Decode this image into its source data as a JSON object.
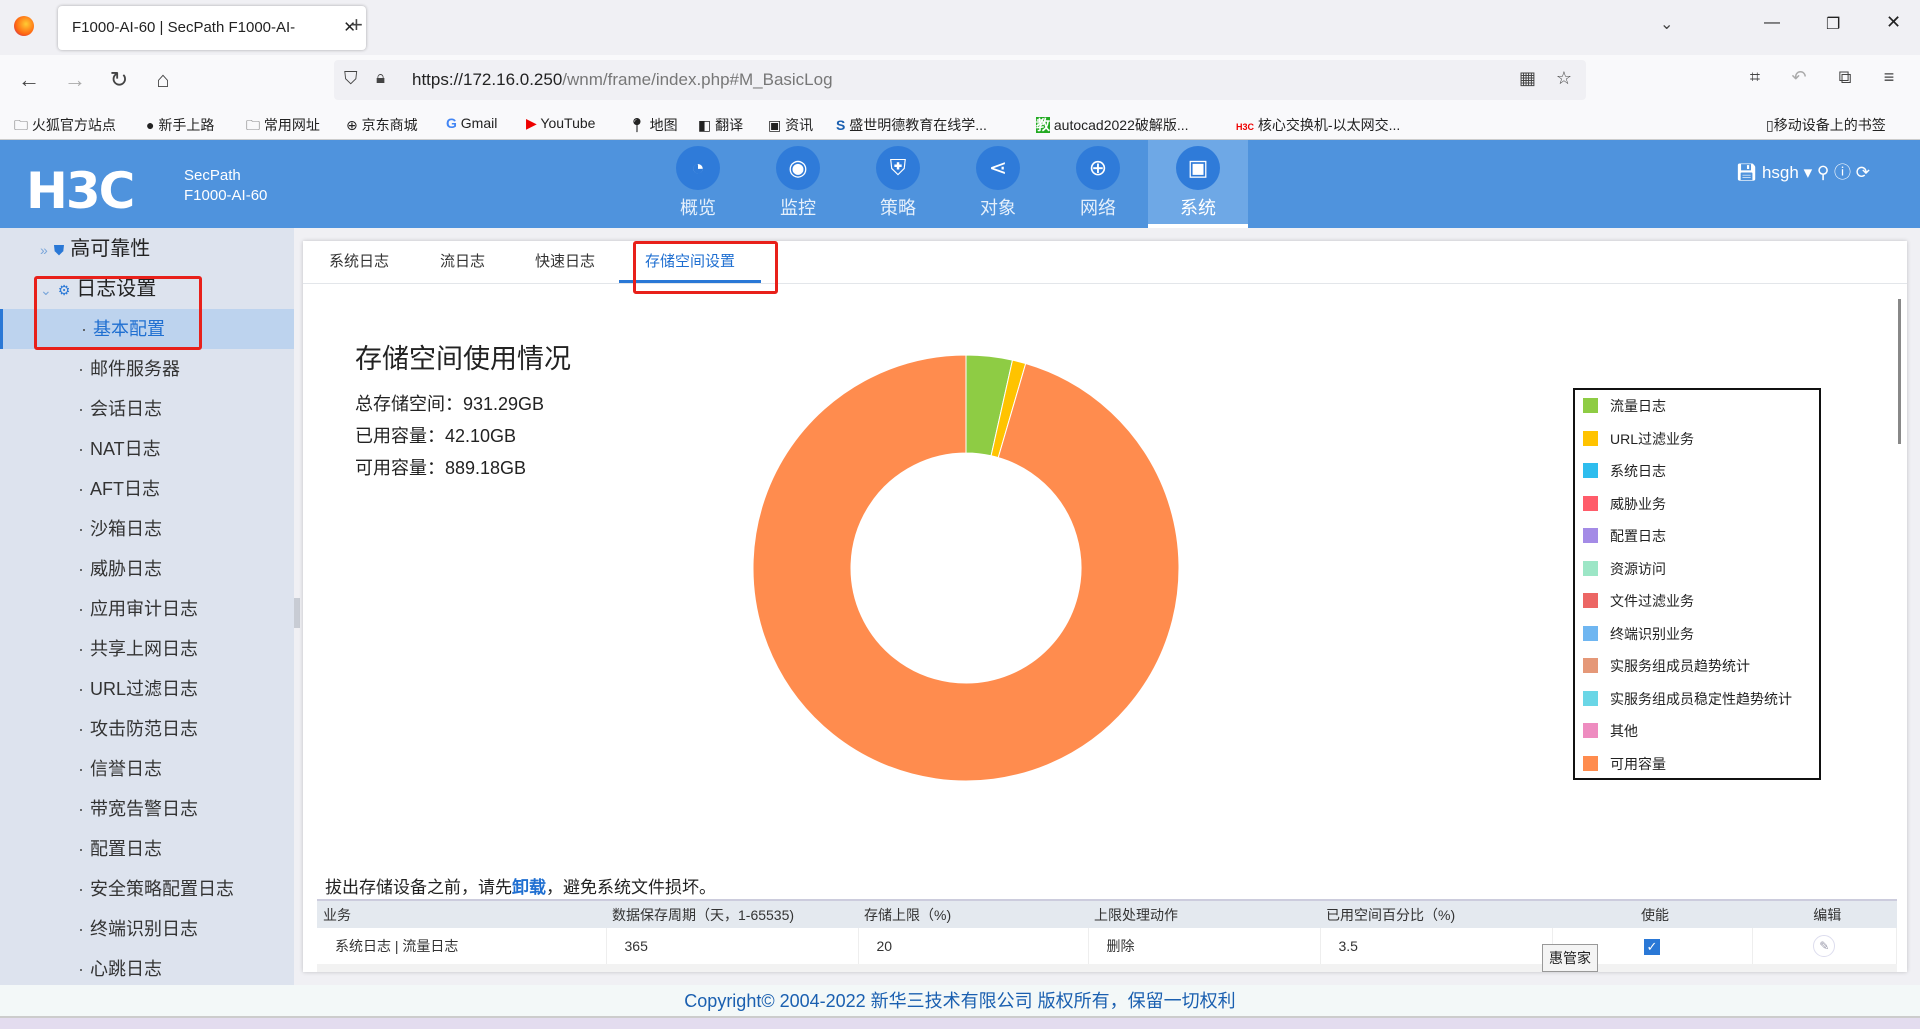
{
  "browser": {
    "tab_title": "F1000-AI-60 | SecPath F1000-AI-",
    "url_host": "https://172.16.0.250",
    "url_path": "/wnm/frame/index.php#M_BasicLog",
    "bookmarks": [
      "火狐官方站点",
      "新手上路",
      "常用网址",
      "京东商城",
      "Gmail",
      "YouTube",
      "地图",
      "翻译",
      "资讯",
      "盛世明德教育在线学...",
      "autocad2022破解版...",
      "核心交换机-以太网交..."
    ],
    "mobile_bookmarks": "移动设备上的书签"
  },
  "header": {
    "logo": "H3C",
    "product": "SecPath",
    "model": "F1000-AI-60",
    "user": "hsgh",
    "menu": [
      {
        "label": "概览",
        "icon": "dashboard-icon"
      },
      {
        "label": "监控",
        "icon": "camera-icon"
      },
      {
        "label": "策略",
        "icon": "shield-icon"
      },
      {
        "label": "对象",
        "icon": "share-icon"
      },
      {
        "label": "网络",
        "icon": "globe-icon"
      },
      {
        "label": "系统",
        "icon": "monitor-icon"
      }
    ]
  },
  "sidebar": {
    "groups": [
      "高可靠性",
      "日志设置"
    ],
    "items": [
      "基本配置",
      "邮件服务器",
      "会话日志",
      "NAT日志",
      "AFT日志",
      "沙箱日志",
      "威胁日志",
      "应用审计日志",
      "共享上网日志",
      "URL过滤日志",
      "攻击防范日志",
      "信誉日志",
      "带宽告警日志",
      "配置日志",
      "安全策略配置日志",
      "终端识别日志",
      "心跳日志"
    ]
  },
  "tabs": [
    "系统日志",
    "流日志",
    "快速日志",
    "存储空间设置"
  ],
  "storage": {
    "title": "存储空间使用情况",
    "total": "总存储空间：931.29GB",
    "used": "已用容量：42.10GB",
    "free": "可用容量：889.18GB"
  },
  "chart_data": {
    "type": "pie",
    "donut": true,
    "unit": "GB",
    "categories": [
      "流量日志",
      "URL过滤业务",
      "系统日志",
      "威胁业务",
      "配置日志",
      "资源访问",
      "文件过滤业务",
      "终端识别业务",
      "实服务组成员趋势统计",
      "实服务组成员稳定性趋势统计",
      "其他",
      "可用容量"
    ],
    "values": [
      32.6,
      9.5,
      0,
      0,
      0,
      0,
      0,
      0,
      0,
      0,
      0,
      889.18
    ],
    "colors": [
      "#8ecc44",
      "#ffc300",
      "#2ebdee",
      "#ff5c6a",
      "#a48be6",
      "#9ce6c6",
      "#ec6664",
      "#6fb6f1",
      "#e59878",
      "#6ad6e6",
      "#ee8cc0",
      "#ff8c4e"
    ],
    "legend": "right"
  },
  "notice": {
    "before": "拔出存储设备之前，请先",
    "link": "卸载",
    "after": "，避免系统文件损坏。"
  },
  "table": {
    "headers": [
      "业务",
      "数据保存周期（天，1-65535)",
      "存储上限（%)",
      "上限处理动作",
      "已用空间百分比（%)",
      "使能",
      "编辑"
    ],
    "rows": [
      [
        "系统日志 | 流量日志",
        "365",
        "20",
        "删除",
        "3.5"
      ]
    ]
  },
  "tooltip": "惠管家",
  "footer": "Copyright© 2004-2022 新华三技术有限公司 版权所有，保留一切权利"
}
